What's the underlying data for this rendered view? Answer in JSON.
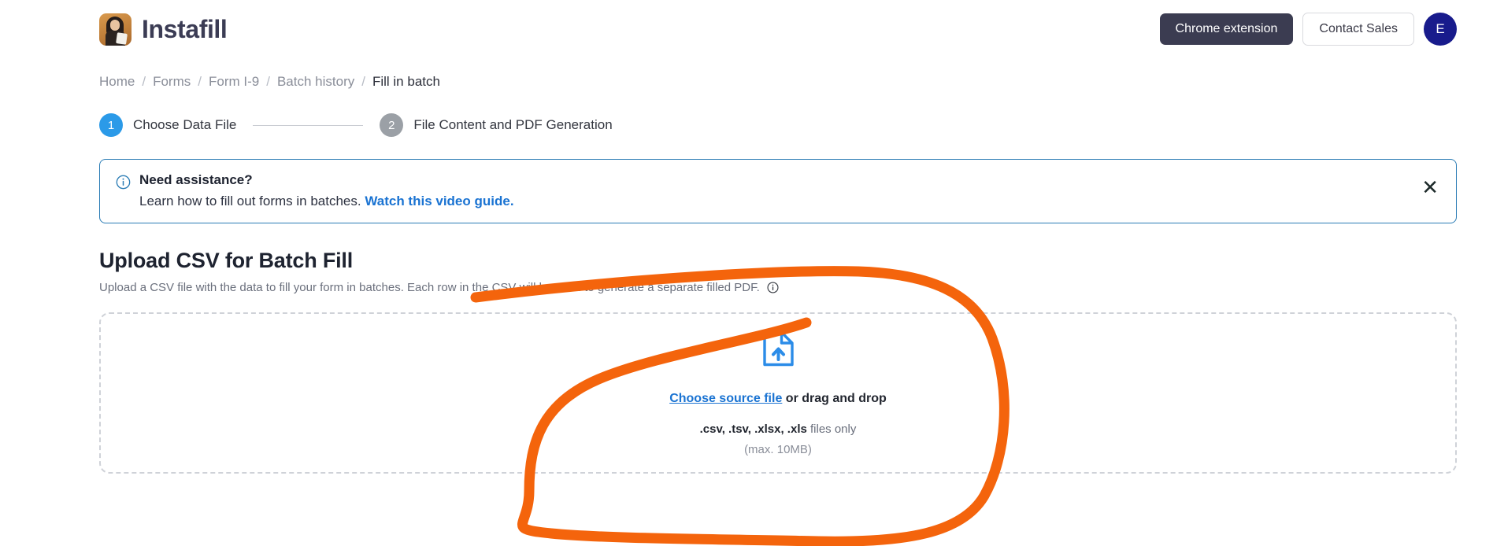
{
  "header": {
    "brand_name": "Instafill",
    "logo_icon": "instafill-avatar-logo",
    "chrome_extension_label": "Chrome extension",
    "contact_sales_label": "Contact Sales",
    "avatar_initial": "E"
  },
  "breadcrumb": {
    "separator": "/",
    "items": [
      {
        "label": "Home",
        "active": false
      },
      {
        "label": "Forms",
        "active": false
      },
      {
        "label": "Form I-9",
        "active": false
      },
      {
        "label": "Batch history",
        "active": false
      },
      {
        "label": "Fill in batch",
        "active": true
      }
    ]
  },
  "stepper": {
    "steps": [
      {
        "number": "1",
        "label": "Choose Data File",
        "state": "active"
      },
      {
        "number": "2",
        "label": "File Content and PDF Generation",
        "state": "inactive"
      }
    ]
  },
  "alert": {
    "icon": "info-circle-icon",
    "title": "Need assistance?",
    "text": "Learn how to fill out forms in batches.",
    "link_label": "Watch this video guide.",
    "close_icon": "close-icon",
    "border_color": "#2b7cb5",
    "link_color": "#1a73d2"
  },
  "upload": {
    "title": "Upload CSV for Batch Fill",
    "description": "Upload a CSV file with the data to fill your form in batches. Each row in the CSV will be used to generate a separate filled PDF.",
    "description_info_icon": "info-circle-icon",
    "dropzone": {
      "icon": "file-upload-icon",
      "icon_color": "#2b8ce8",
      "link_label": "Choose source file",
      "drag_text": "or drag and drop",
      "file_types": ".csv, .tsv, .xlsx, .xls",
      "file_types_suffix": "files only",
      "max_size": "(max. 10MB)"
    }
  },
  "annotation": {
    "type": "freehand-highlight-loop",
    "color": "#f4640c",
    "stroke_width": 13
  }
}
